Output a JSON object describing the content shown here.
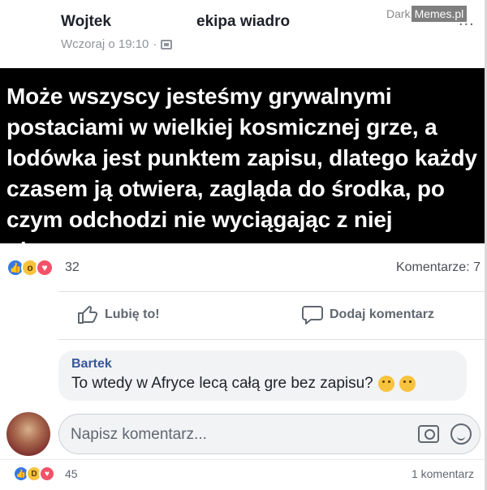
{
  "post": {
    "author": "Wojtek",
    "group": "ekipa wiadro",
    "timestamp": "Wczoraj o 19:10",
    "audience_icon": "photo-icon",
    "more_label": "..."
  },
  "watermark": {
    "part1": "Dark",
    "part2": "Memes.pl"
  },
  "banner_text": "Może wszyscy jesteśmy grywalnymi postaciami w wielkiej kosmicznej grze, a lodówka jest punktem zapisu, dlatego każdy czasem ją otwiera, zagląda do środka, po czym odchodzi nie wyciągając z niej niczego.",
  "reactions": {
    "icons": [
      "like-icon",
      "wow-icon",
      "love-icon"
    ],
    "count": "32",
    "comments": "Komentarze: 7"
  },
  "actions": {
    "like": "Lubię to!",
    "comment": "Dodaj komentarz"
  },
  "comment": {
    "author": "Bartek",
    "text": "To wtedy w Afryce lecą całą gre bez zapisu?",
    "emojis": [
      "thinking-face-icon",
      "grimace-face-icon"
    ]
  },
  "composer": {
    "placeholder": "Napisz komentarz..."
  },
  "footer": {
    "icons": [
      "like-icon",
      "haha-icon",
      "love-icon"
    ],
    "count": "45",
    "comments": "1 komentarz"
  }
}
